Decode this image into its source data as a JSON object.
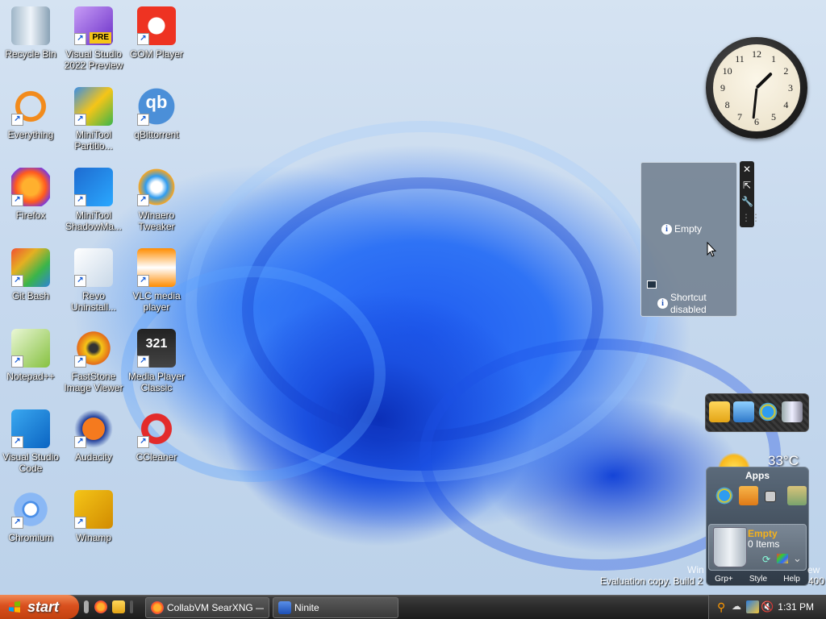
{
  "desktop_icons": [
    {
      "label": "Recycle Bin",
      "icon": "recycle-bin-icon"
    },
    {
      "label": "Visual Studio 2022 Preview",
      "icon": "visual-studio-icon",
      "badge": "PRE"
    },
    {
      "label": "GOM Player",
      "icon": "gom-player-icon"
    },
    {
      "label": "Everything",
      "icon": "everything-search-icon"
    },
    {
      "label": "MiniTool Partitio...",
      "icon": "minitool-partition-icon"
    },
    {
      "label": "qBittorrent",
      "icon": "qbittorrent-icon",
      "glyph": "qb"
    },
    {
      "label": "Firefox",
      "icon": "firefox-icon"
    },
    {
      "label": "MiniTool ShadowMa...",
      "icon": "minitool-shadowmaker-icon"
    },
    {
      "label": "Winaero Tweaker",
      "icon": "winaero-tweaker-icon"
    },
    {
      "label": "Git Bash",
      "icon": "git-bash-icon"
    },
    {
      "label": "Revo Uninstall...",
      "icon": "revo-uninstaller-icon"
    },
    {
      "label": "VLC media player",
      "icon": "vlc-icon"
    },
    {
      "label": "Notepad++",
      "icon": "notepad-plus-plus-icon"
    },
    {
      "label": "FastStone Image Viewer",
      "icon": "faststone-icon"
    },
    {
      "label": "Media Player Classic",
      "icon": "media-player-classic-icon",
      "glyph": "321"
    },
    {
      "label": "Visual Studio Code",
      "icon": "vscode-icon"
    },
    {
      "label": "Audacity",
      "icon": "audacity-icon"
    },
    {
      "label": "CCleaner",
      "icon": "ccleaner-icon"
    },
    {
      "label": "Chromium",
      "icon": "chromium-icon"
    },
    {
      "label": "Winamp",
      "icon": "winamp-icon"
    }
  ],
  "clock": {
    "numbers": [
      "12",
      "1",
      "2",
      "3",
      "4",
      "5",
      "6",
      "7",
      "8",
      "9",
      "10",
      "11"
    ],
    "hour": 1,
    "minute": 31
  },
  "stack_gadget": {
    "empty_label": "Empty",
    "shortcut_label": "Shortcut disabled"
  },
  "weather": {
    "temperature": "33°C"
  },
  "apps_gadget": {
    "title": "Apps",
    "bin_status": "Empty",
    "bin_items": "0 Items",
    "footer": [
      "Grp+",
      "Style",
      "Help"
    ]
  },
  "watermark": {
    "line1_left": "Win",
    "line1_right": "ew",
    "line2_left": "Evaluation copy. Build 2",
    "line2_right": "400"
  },
  "taskbar": {
    "start_label": "start",
    "tasks": [
      {
        "label": "CollabVM SearXNG —...",
        "icon": "firefox-icon"
      },
      {
        "label": "Ninite",
        "icon": "ninite-icon"
      }
    ],
    "time": "1:31 PM"
  },
  "colors": {
    "start_orange": "#d9501e",
    "taskbar_dark": "#2b2b2b",
    "accent_blue": "#1e5af0"
  }
}
